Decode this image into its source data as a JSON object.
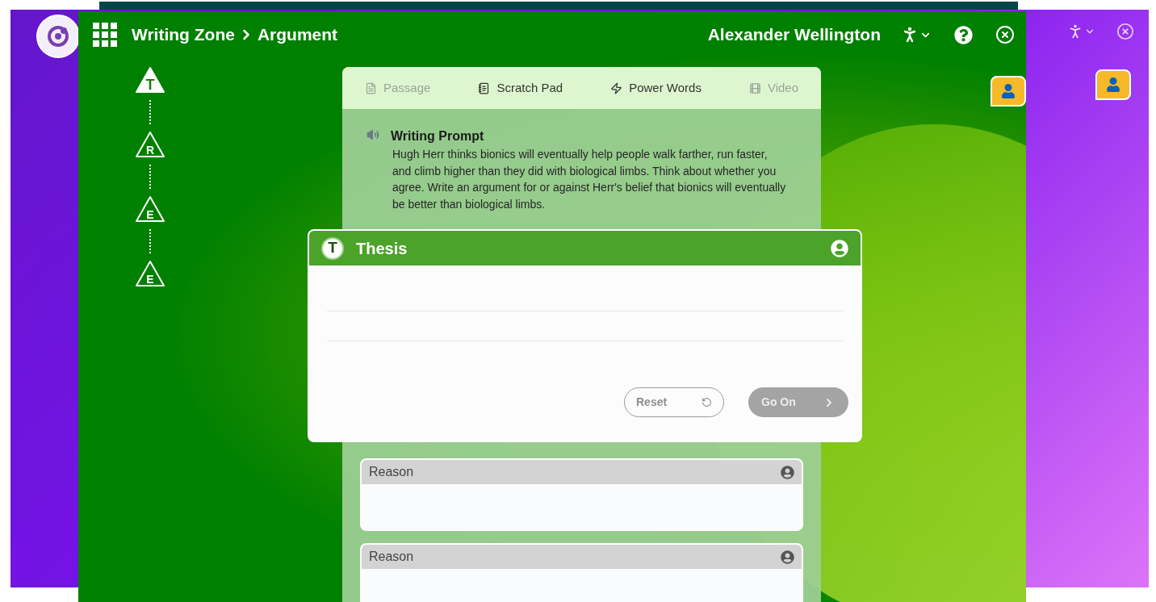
{
  "window": {
    "app_title": "Writing Zone",
    "section": "Argument",
    "user_name": "Alexander Wellington"
  },
  "steps": [
    {
      "letter": "T",
      "selected": true
    },
    {
      "letter": "R",
      "selected": false
    },
    {
      "letter": "E",
      "selected": false
    },
    {
      "letter": "E",
      "selected": false
    }
  ],
  "tabs": [
    {
      "label": "Passage",
      "kind": "passage",
      "disabled": true
    },
    {
      "label": "Scratch Pad",
      "kind": "notes",
      "disabled": false
    },
    {
      "label": "Power Words",
      "kind": "words",
      "disabled": false
    },
    {
      "label": "Video",
      "kind": "video",
      "disabled": true
    }
  ],
  "prompt": {
    "title": "Writing Prompt",
    "text": "Hugh Herr thinks bionics will eventually help people walk farther, run faster, and climb higher than they did with biological limbs. Think about whether you agree. Write an argument for or against Herr's belief that bionics will eventually be better than biological limbs."
  },
  "thesis": {
    "badge": "T",
    "title": "Thesis",
    "reset_label": "Reset",
    "go_on": {
      "label": "Go On",
      "disabled": true
    }
  },
  "reasons": [
    {
      "title": "Reason"
    },
    {
      "title": "Reason"
    }
  ]
}
